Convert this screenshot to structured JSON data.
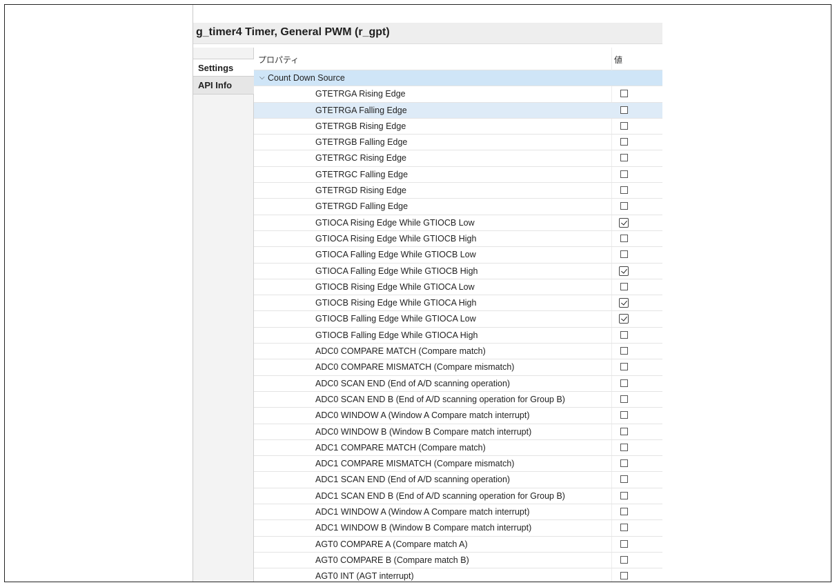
{
  "title": "g_timer4 Timer, General PWM (r_gpt)",
  "tabs": [
    {
      "label": "Settings",
      "active": true
    },
    {
      "label": "API Info",
      "active": false
    }
  ],
  "table": {
    "headers": {
      "property": "プロパティ",
      "value": "値"
    },
    "group": {
      "label": "Count Down Source",
      "expanded": true
    },
    "rows": [
      {
        "label": "GTETRGA Rising Edge",
        "checked": false
      },
      {
        "label": "GTETRGA Falling Edge",
        "checked": false,
        "highlight": true
      },
      {
        "label": "GTETRGB Rising Edge",
        "checked": false
      },
      {
        "label": "GTETRGB Falling Edge",
        "checked": false
      },
      {
        "label": "GTETRGC Rising Edge",
        "checked": false
      },
      {
        "label": "GTETRGC Falling Edge",
        "checked": false
      },
      {
        "label": "GTETRGD Rising Edge",
        "checked": false
      },
      {
        "label": "GTETRGD Falling Edge",
        "checked": false
      },
      {
        "label": "GTIOCA Rising Edge While GTIOCB Low",
        "checked": true
      },
      {
        "label": "GTIOCA Rising Edge While GTIOCB High",
        "checked": false
      },
      {
        "label": "GTIOCA Falling Edge While GTIOCB Low",
        "checked": false
      },
      {
        "label": "GTIOCA Falling Edge While GTIOCB High",
        "checked": true
      },
      {
        "label": "GTIOCB Rising Edge While GTIOCA Low",
        "checked": false
      },
      {
        "label": "GTIOCB Rising Edge While GTIOCA High",
        "checked": true
      },
      {
        "label": "GTIOCB Falling Edge While GTIOCA Low",
        "checked": true
      },
      {
        "label": "GTIOCB Falling Edge While GTIOCA High",
        "checked": false
      },
      {
        "label": "ADC0 COMPARE MATCH (Compare match)",
        "checked": false
      },
      {
        "label": "ADC0 COMPARE MISMATCH (Compare mismatch)",
        "checked": false
      },
      {
        "label": "ADC0 SCAN END (End of A/D scanning operation)",
        "checked": false
      },
      {
        "label": "ADC0 SCAN END B (End of A/D scanning operation for Group B)",
        "checked": false
      },
      {
        "label": "ADC0 WINDOW A (Window A Compare match interrupt)",
        "checked": false
      },
      {
        "label": "ADC0 WINDOW B (Window B Compare match interrupt)",
        "checked": false
      },
      {
        "label": "ADC1 COMPARE MATCH (Compare match)",
        "checked": false
      },
      {
        "label": "ADC1 COMPARE MISMATCH (Compare mismatch)",
        "checked": false
      },
      {
        "label": "ADC1 SCAN END (End of A/D scanning operation)",
        "checked": false
      },
      {
        "label": "ADC1 SCAN END B (End of A/D scanning operation for Group B)",
        "checked": false
      },
      {
        "label": "ADC1 WINDOW A (Window A Compare match interrupt)",
        "checked": false
      },
      {
        "label": "ADC1 WINDOW B (Window B Compare match interrupt)",
        "checked": false
      },
      {
        "label": "AGT0 COMPARE A (Compare match A)",
        "checked": false
      },
      {
        "label": "AGT0 COMPARE B (Compare match B)",
        "checked": false
      },
      {
        "label": "AGT0 INT (AGT interrupt)",
        "checked": false
      }
    ]
  },
  "colors": {
    "group_row": "#cfe5f7",
    "selected_row": "#deebf7",
    "title_bar": "#eeeeee"
  }
}
